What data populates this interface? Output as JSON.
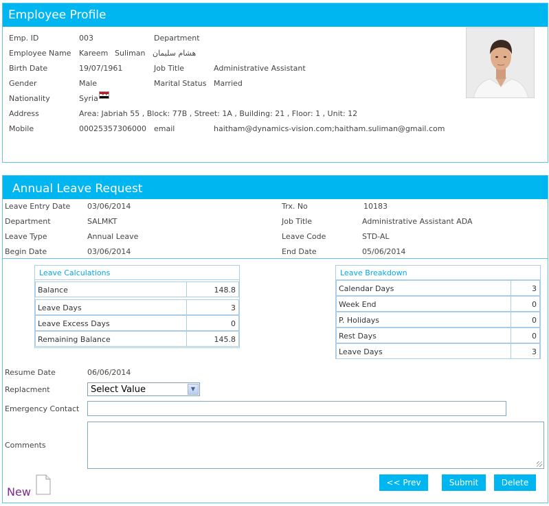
{
  "profile": {
    "title": "Employee Profile",
    "emp_id_label": "Emp. ID",
    "emp_id": "003",
    "department_label": "Department",
    "department": "",
    "name_label": "Employee Name",
    "first_name": "Kareem",
    "last_name": "Suliman",
    "arabic_name": "هشام سليمان",
    "birth_date_label": "Birth Date",
    "birth_date": "19/07/1961",
    "job_title_label": "Job Title",
    "job_title": "Administrative Assistant",
    "gender_label": "Gender",
    "gender": "Male",
    "marital_label": "Marital Status",
    "marital": "Married",
    "nationality_label": "Nationality",
    "nationality": "Syria",
    "address_label": "Address",
    "address": "Area: Jabriah 55 , Block: 77B , Street: 1A , Building: 21 , Floor: 1 , Unit: 12",
    "mobile_label": "Mobile",
    "mobile": "00025357306000",
    "email_label": "email",
    "email": "haitham@dynamics-vision.com;haitham.suliman@gmail.com"
  },
  "leave": {
    "title": "Annual Leave Request",
    "entry_date_label": "Leave Entry Date",
    "entry_date": "03/06/2014",
    "trx_label": "Trx. No",
    "trx": "10183",
    "department_label": "Department",
    "department": "SALMKT",
    "job_title_label": "Job Title",
    "job_title": "Administrative Assistant  ADA",
    "type_label": "Leave Type",
    "type": "Annual Leave",
    "code_label": "Leave Code",
    "code": "STD-AL",
    "begin_label": "Begin Date",
    "begin": "03/06/2014",
    "end_label": "End Date",
    "end": "05/06/2014",
    "calc": {
      "title": "Leave Calculations",
      "rows": [
        {
          "label": "Balance",
          "value": "148.8"
        },
        {
          "label": "Leave Days",
          "value": "3"
        },
        {
          "label": "Leave Excess Days",
          "value": "0"
        },
        {
          "label": "Remaining Balance",
          "value": "145.8"
        }
      ]
    },
    "breakdown": {
      "title": "Leave Breakdown",
      "rows": [
        {
          "label": "Calendar Days",
          "value": "3"
        },
        {
          "label": "Week End",
          "value": "0"
        },
        {
          "label": "P. Holidays",
          "value": "0"
        },
        {
          "label": "Rest Days",
          "value": "0"
        },
        {
          "label": "Leave Days",
          "value": "3"
        }
      ]
    },
    "resume_label": "Resume Date",
    "resume": "06/06/2014",
    "replacement_label": "Replacment",
    "replacement_value": "Select Value",
    "emergency_label": "Emergency Contact",
    "emergency_value": "",
    "comments_label": "Comments",
    "comments_value": ""
  },
  "actions": {
    "prev": "<< Prev",
    "submit": "Submit",
    "delete": "Delete",
    "new": "New"
  },
  "colors": {
    "header": "#00b6f0",
    "border": "#5cc4ec",
    "grid_border": "#a9cde8"
  }
}
